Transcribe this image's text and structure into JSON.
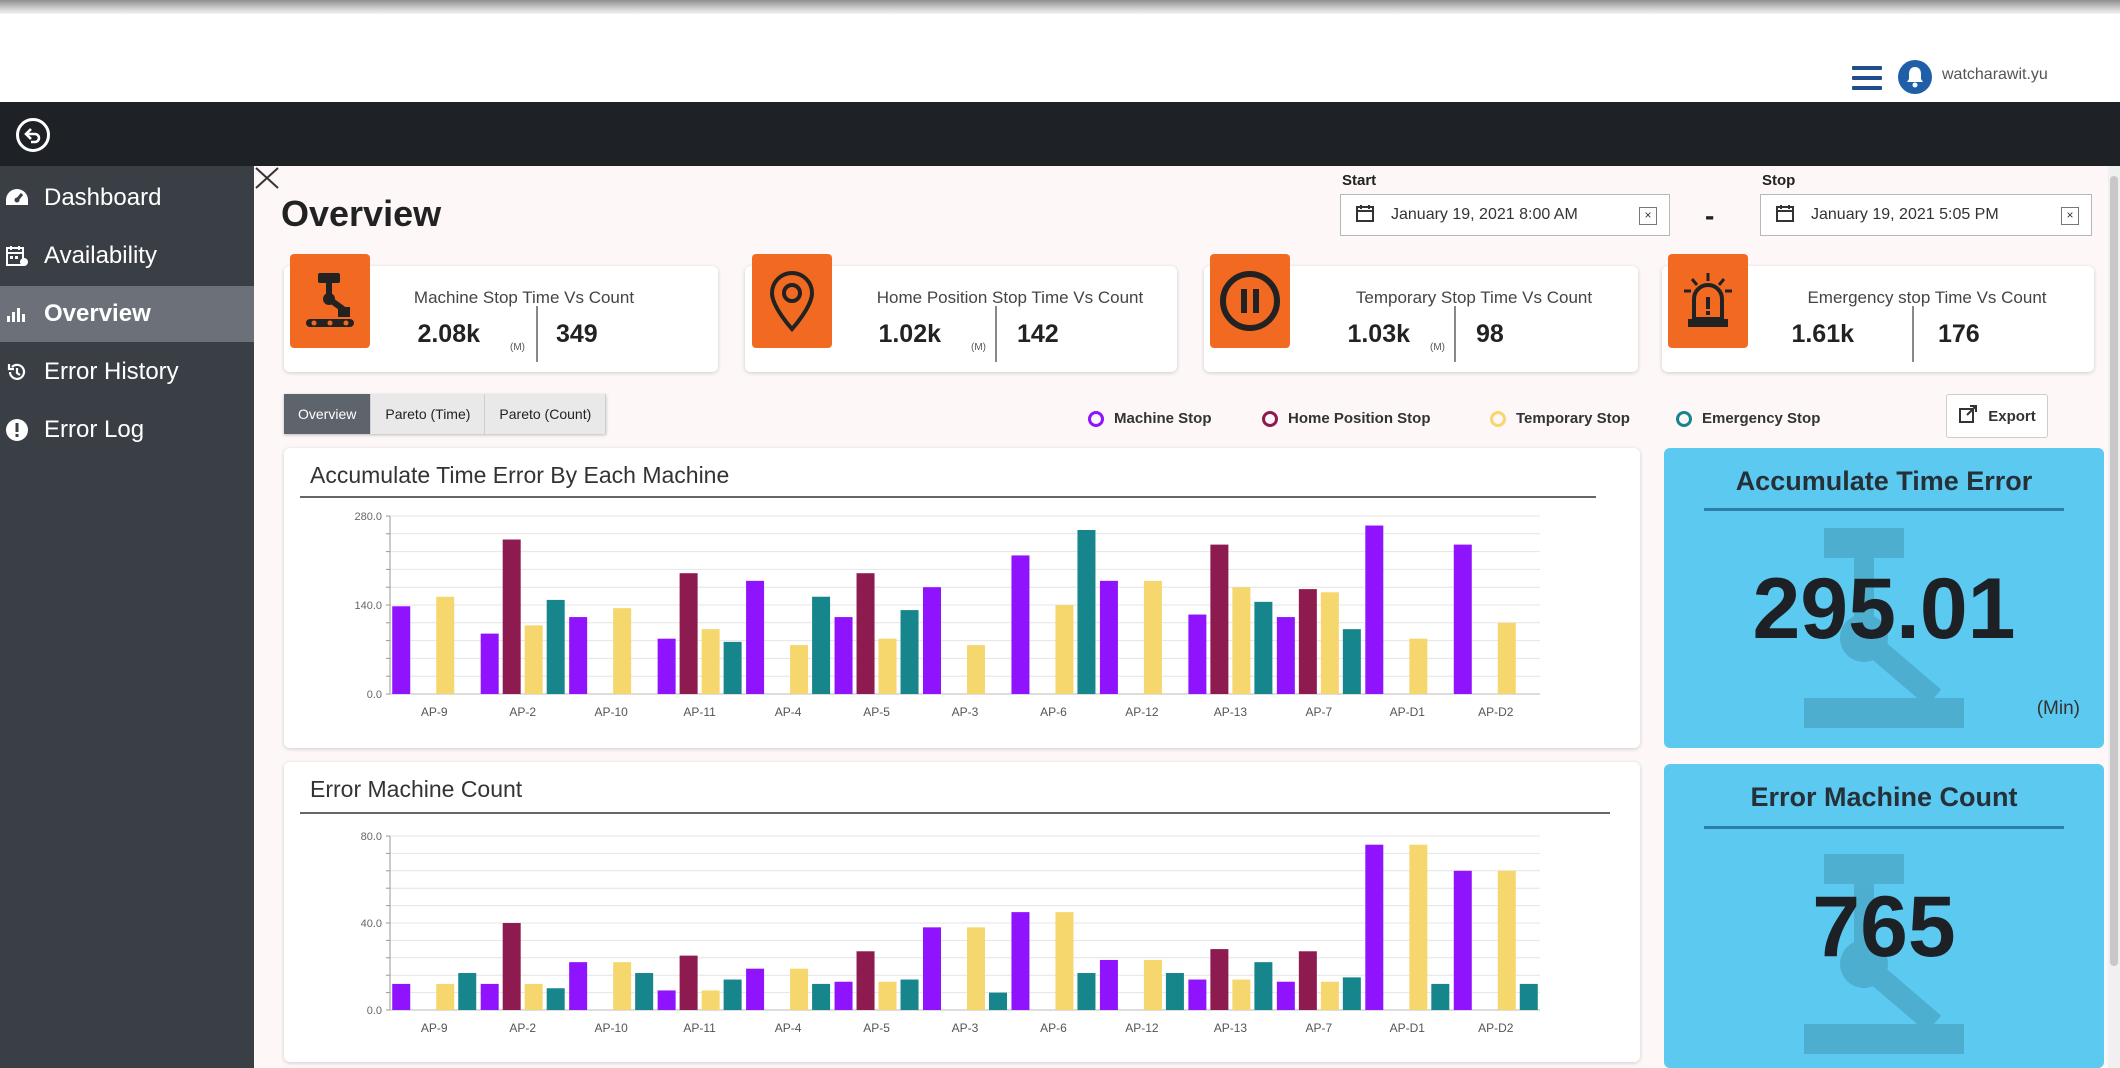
{
  "header": {
    "username": "watcharawit.yu"
  },
  "sidebar": {
    "items": [
      {
        "label": "Dashboard",
        "icon": "dashboard-icon",
        "active": false
      },
      {
        "label": "Availability",
        "icon": "calendar-icon",
        "active": false
      },
      {
        "label": "Overview",
        "icon": "bar-chart-icon",
        "active": true
      },
      {
        "label": "Error History",
        "icon": "history-icon",
        "active": false
      },
      {
        "label": "Error Log",
        "icon": "alert-icon",
        "active": false
      }
    ]
  },
  "page": {
    "title": "Overview"
  },
  "dates": {
    "start_label": "Start",
    "start_value": "January 19, 2021 8:00 AM",
    "stop_label": "Stop",
    "stop_value": "January 19, 2021 5:05 PM",
    "separator": "-"
  },
  "summary_cards": [
    {
      "title": "Machine Stop Time Vs Count",
      "time": "2.08k",
      "unit": "(M)",
      "count": "349",
      "icon": "robot-arm-icon"
    },
    {
      "title": "Home Position Stop Time Vs Count",
      "time": "1.02k",
      "unit": "(M)",
      "count": "142",
      "icon": "location-pin-icon"
    },
    {
      "title": "Temporary Stop Time Vs Count",
      "time": "1.03k",
      "unit": "(M)",
      "count": "98",
      "icon": "pause-icon"
    },
    {
      "title": "Emergency stop Time Vs Count",
      "time": "1.61k",
      "unit": "",
      "count": "176",
      "icon": "alarm-siren-icon"
    }
  ],
  "tabs": [
    {
      "label": "Overview"
    },
    {
      "label": "Pareto (Time)"
    },
    {
      "label": "Pareto (Count)"
    }
  ],
  "legend": [
    {
      "label": "Machine Stop",
      "color": "#9013fe"
    },
    {
      "label": "Home Position Stop",
      "color": "#8e1b4f"
    },
    {
      "label": "Temporary Stop",
      "color": "#f5d76e"
    },
    {
      "label": "Emergency Stop",
      "color": "#16868c"
    }
  ],
  "export_label": "Export",
  "kpis": {
    "time": {
      "title": "Accumulate Time Error",
      "value": "295.01",
      "unit": "(Min)"
    },
    "count": {
      "title": "Error Machine Count",
      "value": "765"
    }
  },
  "chart_data": [
    {
      "type": "bar",
      "title": "Accumulate Time Error By Each Machine",
      "categories": [
        "AP-9",
        "AP-2",
        "AP-10",
        "AP-11",
        "AP-4",
        "AP-5",
        "AP-3",
        "AP-6",
        "AP-12",
        "AP-13",
        "AP-7",
        "AP-D1",
        "AP-D2"
      ],
      "ylim": [
        0,
        280
      ],
      "yticks": [
        "0.0",
        "140.0",
        "280.0"
      ],
      "colors": [
        "#9013fe",
        "#8e1b4f",
        "#f5d76e",
        "#16868c"
      ],
      "series": [
        {
          "name": "Machine Stop",
          "values": [
            138,
            95,
            121,
            87,
            178,
            121,
            168,
            218,
            178,
            125,
            121,
            265,
            235
          ]
        },
        {
          "name": "Home Position Stop",
          "values": [
            0,
            243,
            0,
            190,
            0,
            190,
            0,
            0,
            0,
            235,
            165,
            0,
            0
          ]
        },
        {
          "name": "Temporary Stop",
          "values": [
            153,
            108,
            135,
            102,
            77,
            87,
            77,
            140,
            178,
            168,
            160,
            87,
            112
          ]
        },
        {
          "name": "Emergency Stop",
          "values": [
            0,
            148,
            0,
            82,
            153,
            132,
            0,
            258,
            0,
            145,
            102,
            0,
            0
          ]
        }
      ]
    },
    {
      "type": "bar",
      "title": "Error Machine Count",
      "categories": [
        "AP-9",
        "AP-2",
        "AP-10",
        "AP-11",
        "AP-4",
        "AP-5",
        "AP-3",
        "AP-6",
        "AP-12",
        "AP-13",
        "AP-7",
        "AP-D1",
        "AP-D2"
      ],
      "ylim": [
        0,
        80
      ],
      "yticks": [
        "0.0",
        "40.0",
        "80.0"
      ],
      "colors": [
        "#9013fe",
        "#8e1b4f",
        "#f5d76e",
        "#16868c"
      ],
      "series": [
        {
          "name": "Machine Stop",
          "values": [
            12,
            12,
            22,
            9,
            19,
            13,
            38,
            45,
            23,
            14,
            13,
            76,
            64
          ]
        },
        {
          "name": "Home Position Stop",
          "values": [
            0,
            40,
            0,
            25,
            0,
            27,
            0,
            0,
            0,
            28,
            27,
            0,
            0
          ]
        },
        {
          "name": "Temporary Stop",
          "values": [
            12,
            12,
            22,
            9,
            19,
            13,
            38,
            45,
            23,
            14,
            13,
            76,
            64
          ]
        },
        {
          "name": "Emergency Stop",
          "values": [
            17,
            10,
            17,
            14,
            12,
            14,
            8,
            17,
            17,
            22,
            15,
            12,
            12
          ]
        }
      ]
    }
  ]
}
